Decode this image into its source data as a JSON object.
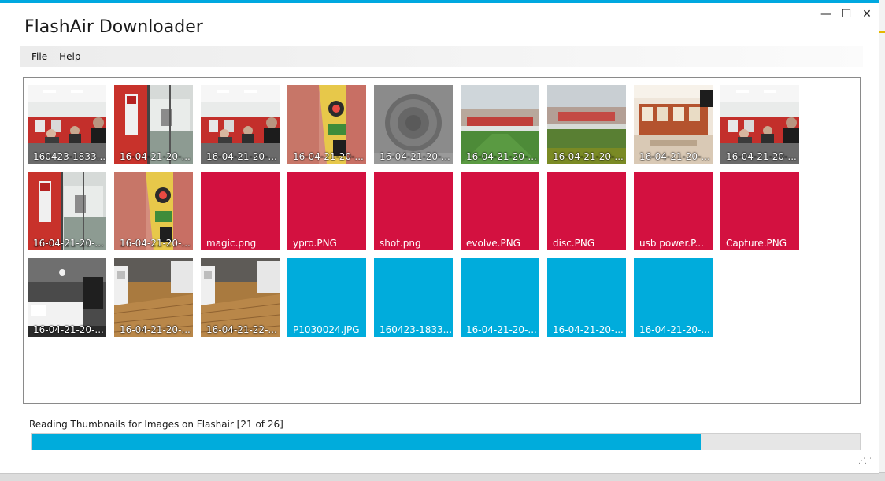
{
  "window": {
    "title": "FlashAir Downloader",
    "controls": {
      "minimize": "—",
      "maximize": "☐",
      "close": "✕"
    },
    "accent_color": "#00a8e0"
  },
  "menu": {
    "items": [
      "File",
      "Help"
    ]
  },
  "gallery": {
    "tiles": [
      {
        "caption": "160423-1833...",
        "kind": "photo",
        "thumb": "team-lobby"
      },
      {
        "caption": "16-04-21-20-...",
        "kind": "photo",
        "thumb": "window-mascot"
      },
      {
        "caption": "16-04-21-20-...",
        "kind": "photo",
        "thumb": "team-lobby"
      },
      {
        "caption": "16-04-21-20-...",
        "kind": "photo",
        "thumb": "mural-closeup"
      },
      {
        "caption": "16-04-21-20-...",
        "kind": "photo",
        "thumb": "manhole-cover"
      },
      {
        "caption": "16-04-21-20-...",
        "kind": "photo",
        "thumb": "stadium-pitch"
      },
      {
        "caption": "16-04-21-20-...",
        "kind": "photo",
        "thumb": "stadium-pitch-2"
      },
      {
        "caption": "16-04-21-20-...",
        "kind": "photo",
        "thumb": "trophy-room"
      },
      {
        "caption": "16-04-21-20-...",
        "kind": "photo",
        "thumb": "team-lobby"
      },
      {
        "caption": "16-04-21-20-...",
        "kind": "photo",
        "thumb": "window-mascot"
      },
      {
        "caption": "16-04-21-20-...",
        "kind": "photo",
        "thumb": "mural-closeup"
      },
      {
        "caption": "magic.png",
        "kind": "red"
      },
      {
        "caption": "ypro.PNG",
        "kind": "red"
      },
      {
        "caption": "shot.png",
        "kind": "red"
      },
      {
        "caption": "evolve.PNG",
        "kind": "red"
      },
      {
        "caption": "disc.PNG",
        "kind": "red"
      },
      {
        "caption": "usb power.P...",
        "kind": "red"
      },
      {
        "caption": "Capture.PNG",
        "kind": "red"
      },
      {
        "caption": "16-04-21-20-...",
        "kind": "photo",
        "thumb": "dark-room"
      },
      {
        "caption": "16-04-21-20-...",
        "kind": "photo",
        "thumb": "wood-floor"
      },
      {
        "caption": "16-04-21-22-...",
        "kind": "photo",
        "thumb": "wood-floor"
      },
      {
        "caption": "P1030024.JPG",
        "kind": "blue"
      },
      {
        "caption": "160423-1833...",
        "kind": "blue"
      },
      {
        "caption": "16-04-21-20-...",
        "kind": "blue"
      },
      {
        "caption": "16-04-21-20-...",
        "kind": "blue"
      },
      {
        "caption": "16-04-21-20-...",
        "kind": "blue"
      }
    ],
    "colors": {
      "pending_image": "#d31140",
      "pending_photo": "#00acdc"
    }
  },
  "status": {
    "text": "Reading Thumbnails for Images on Flashair [21 of 26]",
    "progress_fraction": 0.8077
  }
}
